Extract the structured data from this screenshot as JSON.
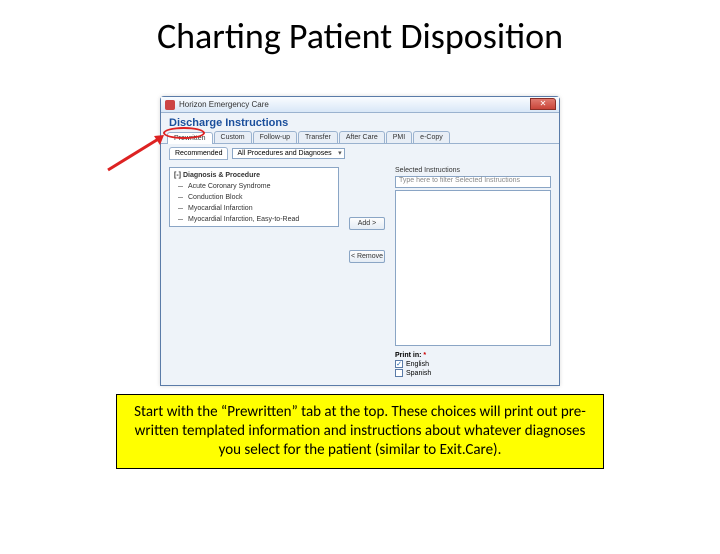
{
  "slide": {
    "title": "Charting Patient Disposition",
    "caption": "Start with the “Prewritten” tab at the top. These choices will print out pre-written templated information and instructions about whatever diagnoses you select for the patient (similar to Exit.Care)."
  },
  "window": {
    "app_title": "Horizon Emergency Care",
    "close_glyph": "✕",
    "heading": "Discharge Instructions",
    "tabs": [
      "Prewritten",
      "Custom",
      "Follow-up",
      "Transfer",
      "After Care",
      "PMI",
      "e-Copy"
    ],
    "subtab": "Recommended",
    "dropdown": "All Procedures and Diagnoses",
    "tree": {
      "collapse_glyph": "[-]",
      "root": "Diagnosis & Procedure",
      "items": [
        "Acute Coronary Syndrome",
        "Conduction Block",
        "Myocardial Infarction",
        "Myocardial Infarction, Easy-to-Read"
      ]
    },
    "buttons": {
      "add": "Add >",
      "remove": "< Remove"
    },
    "right": {
      "label": "Selected Instructions",
      "filter_placeholder": "Type here to filter Selected Instructions"
    },
    "printin": {
      "label": "Print in:",
      "req": "*",
      "options": [
        "English",
        "Spanish"
      ],
      "checked_glyph": "✓"
    }
  }
}
